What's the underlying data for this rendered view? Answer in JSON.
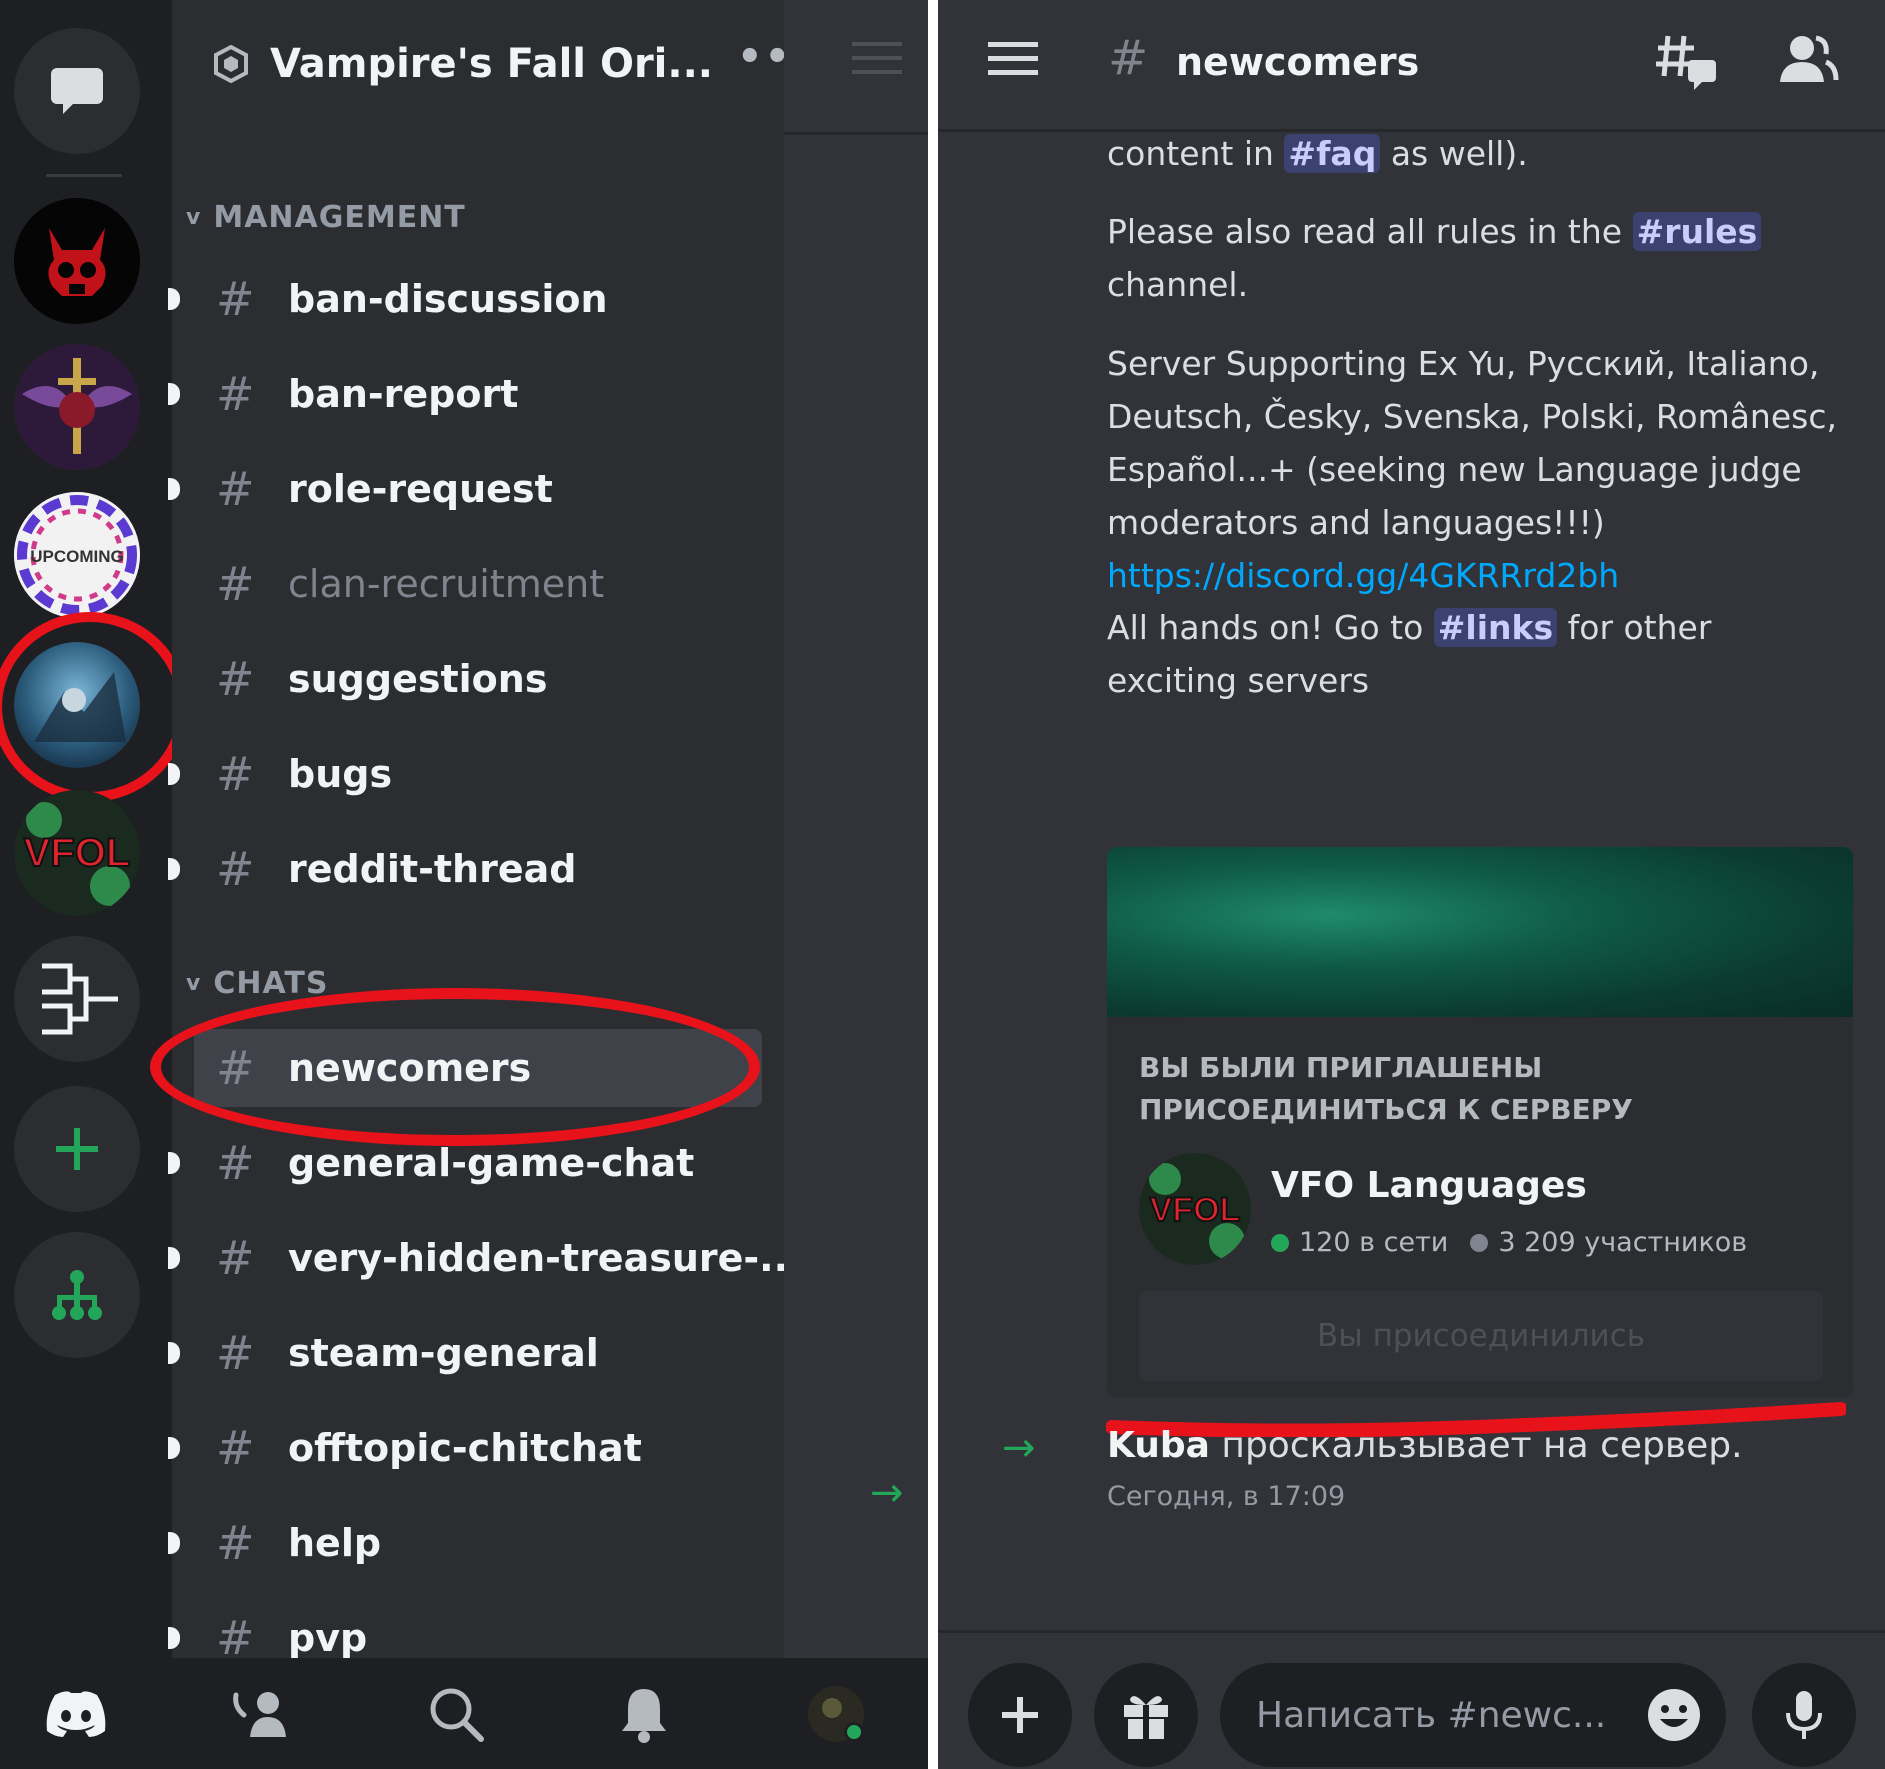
{
  "left": {
    "server_name": "Vampire's Fall Ori...",
    "more_label": "•••",
    "rail": [
      {
        "name": "dm-button"
      },
      {
        "name": "server-red-skull"
      },
      {
        "name": "server-winged-sword"
      },
      {
        "name": "server-upcoming-events",
        "text": "UPCOMING"
      },
      {
        "name": "server-vampires-fall",
        "selected": true
      },
      {
        "name": "server-vfol",
        "text": "VFOL"
      },
      {
        "name": "server-brackets"
      },
      {
        "name": "add-server-button"
      },
      {
        "name": "explore-servers-button"
      }
    ],
    "categories": {
      "management": "MANAGEMENT",
      "chats": "CHATS"
    },
    "channels_management": [
      {
        "label": "ban-discussion",
        "unread": true
      },
      {
        "label": "ban-report",
        "unread": true
      },
      {
        "label": "role-request",
        "unread": true
      },
      {
        "label": "clan-recruitment",
        "muted": true
      },
      {
        "label": "suggestions",
        "unread": false
      },
      {
        "label": "bugs",
        "unread": true
      },
      {
        "label": "reddit-thread",
        "unread": true
      }
    ],
    "channels_chats": [
      {
        "label": "newcomers",
        "selected": true
      },
      {
        "label": "general-game-chat",
        "unread": true
      },
      {
        "label": "very-hidden-treasure-...",
        "unread": true
      },
      {
        "label": "steam-general",
        "unread": true
      },
      {
        "label": "offtopic-chitchat",
        "unread": true
      },
      {
        "label": "help",
        "unread": true
      },
      {
        "label": "pvp",
        "unread": true
      }
    ]
  },
  "right": {
    "channel_name": "newcomers",
    "messages": {
      "p1_pre": "content in ",
      "p1_mention": "#faq",
      "p1_post": " as well).",
      "p2_pre": "Please also read all rules in the ",
      "p2_mention": "#rules",
      "p2_post": " channel.",
      "p3": "Server Supporting Ex Yu, Русский, Italiano, Deutsch, Česky, Svenska, Polski, Românesc, Español...+ (seeking new Language judge moderators and languages!!!)",
      "p3_link": "https://discord.gg/4GKRRrd2bh",
      "p4_pre": "All hands on! Go to ",
      "p4_mention": "#links",
      "p4_post": " for other exciting servers"
    },
    "invite": {
      "heading": "ВЫ БЫЛИ ПРИГЛАШЕНЫ ПРИСОЕДИНИТЬСЯ К СЕРВЕРУ",
      "server_name": "VFO Languages",
      "online": "120 в сети",
      "members": "3 209 участников",
      "button": "Вы присоединились",
      "online_color": "#23a55a",
      "members_color": "#80848e"
    },
    "join": {
      "user": "Kuba",
      "text": " проскальзывает на сервер.",
      "time": "Сегодня, в 17:09"
    },
    "composer": {
      "placeholder": "Написать #newc..."
    }
  },
  "colors": {
    "annotation_red": "#e8121a",
    "mention_bg": "#3c4270",
    "link": "#00a8fc",
    "green": "#23a55a"
  }
}
